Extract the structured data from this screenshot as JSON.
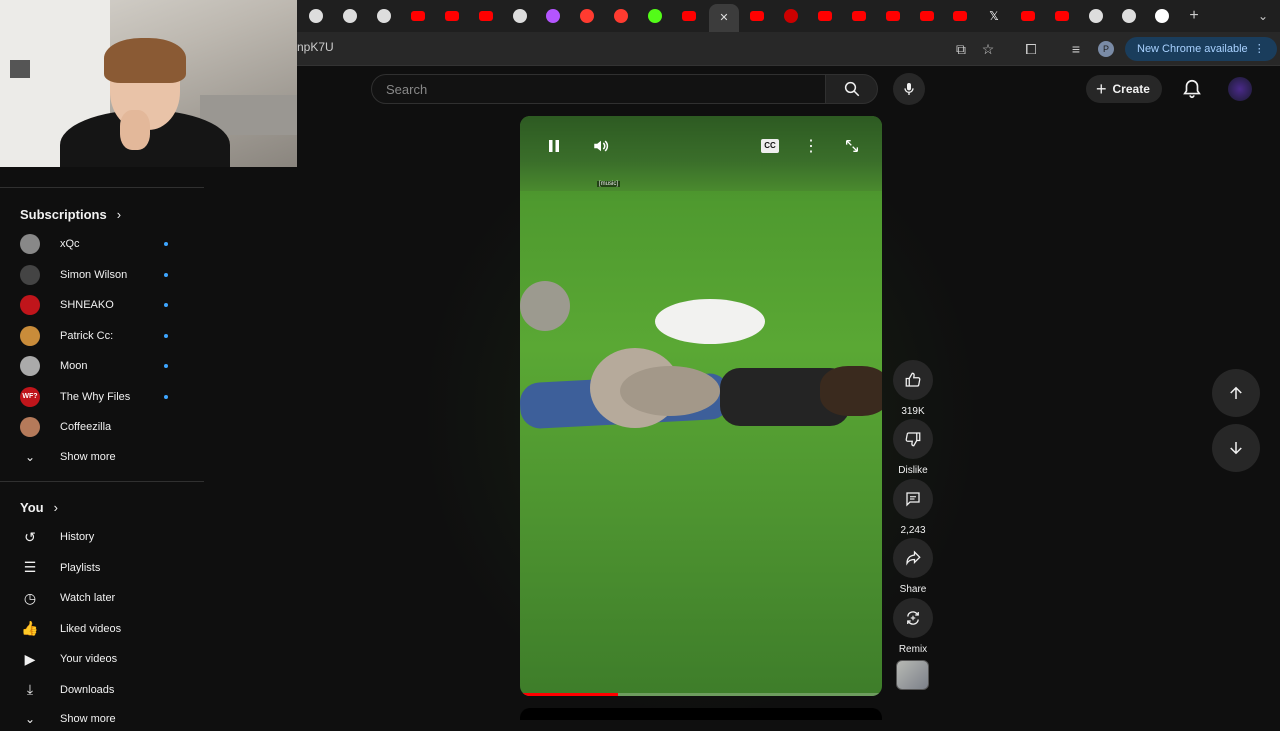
{
  "browser": {
    "url_fragment": "npK7U",
    "new_chrome_label": "New Chrome available",
    "profile_initial": "P",
    "tabs": [
      {
        "icon": "threads-icon",
        "color": "#dddddd"
      },
      {
        "icon": "threads-icon",
        "color": "#dddddd"
      },
      {
        "icon": "threads-icon",
        "color": "#dddddd"
      },
      {
        "icon": "youtube-icon",
        "color": "#ff0000"
      },
      {
        "icon": "youtube-icon",
        "color": "#ff0000"
      },
      {
        "icon": "youtube-icon",
        "color": "#ff0000"
      },
      {
        "icon": "record-icon",
        "color": "#dddddd"
      },
      {
        "icon": "color-wheel-icon",
        "color": "#b455ff"
      },
      {
        "icon": "app-red-icon",
        "color": "#ff3b30"
      },
      {
        "icon": "app-red-icon",
        "color": "#ff3b30"
      },
      {
        "icon": "kick-icon",
        "color": "#53fc18"
      },
      {
        "icon": "youtube-icon",
        "color": "#ff0000"
      },
      {
        "icon": "close-icon",
        "color": "#dddddd",
        "active": true
      },
      {
        "icon": "youtube-icon",
        "color": "#ff0000"
      },
      {
        "icon": "app-red-icon",
        "color": "#cc0000"
      },
      {
        "icon": "youtube-icon",
        "color": "#ff0000"
      },
      {
        "icon": "youtube-icon",
        "color": "#ff0000"
      },
      {
        "icon": "youtube-icon",
        "color": "#ff0000"
      },
      {
        "icon": "youtube-icon",
        "color": "#ff0000"
      },
      {
        "icon": "youtube-icon",
        "color": "#ff0000"
      },
      {
        "icon": "x-icon",
        "color": "#ffffff"
      },
      {
        "icon": "youtube-icon",
        "color": "#ff0000"
      },
      {
        "icon": "youtube-icon",
        "color": "#ff0000"
      },
      {
        "icon": "chrome-icon",
        "color": "#dddddd"
      },
      {
        "icon": "chrome-icon",
        "color": "#dddddd"
      },
      {
        "icon": "profile-icon",
        "color": "#ffffff"
      }
    ]
  },
  "header": {
    "search_placeholder": "Search",
    "create_label": "Create"
  },
  "sidebar": {
    "subscriptions_title": "Subscriptions",
    "subscriptions": [
      {
        "name": "xQc",
        "color": "#888888"
      },
      {
        "name": "Simon Wilson",
        "color": "#444444"
      },
      {
        "name": "SHNEAKO",
        "color": "#c0151b"
      },
      {
        "name": "Patrick Cc:",
        "color": "#c98c3a"
      },
      {
        "name": "Moon",
        "color": "#aaaaaa"
      },
      {
        "name": "The Why Files",
        "color": "#c0151b",
        "badge": "WF?"
      },
      {
        "name": "Coffeezilla",
        "color": "#b57a5a"
      }
    ],
    "show_more": "Show more",
    "you_title": "You",
    "you_items": [
      {
        "label": "History",
        "icon": "history-icon"
      },
      {
        "label": "Playlists",
        "icon": "playlists-icon"
      },
      {
        "label": "Watch later",
        "icon": "clock-icon"
      },
      {
        "label": "Liked videos",
        "icon": "thumbs-up-icon"
      },
      {
        "label": "Your videos",
        "icon": "video-icon"
      },
      {
        "label": "Downloads",
        "icon": "download-icon"
      }
    ],
    "show_more_2": "Show more"
  },
  "player": {
    "caption": "[music]",
    "cc_label": "CC",
    "progress_fraction": 0.27
  },
  "actions": {
    "likes": "319K",
    "dislike_label": "Dislike",
    "comments": "2,243",
    "share_label": "Share",
    "remix_label": "Remix"
  }
}
